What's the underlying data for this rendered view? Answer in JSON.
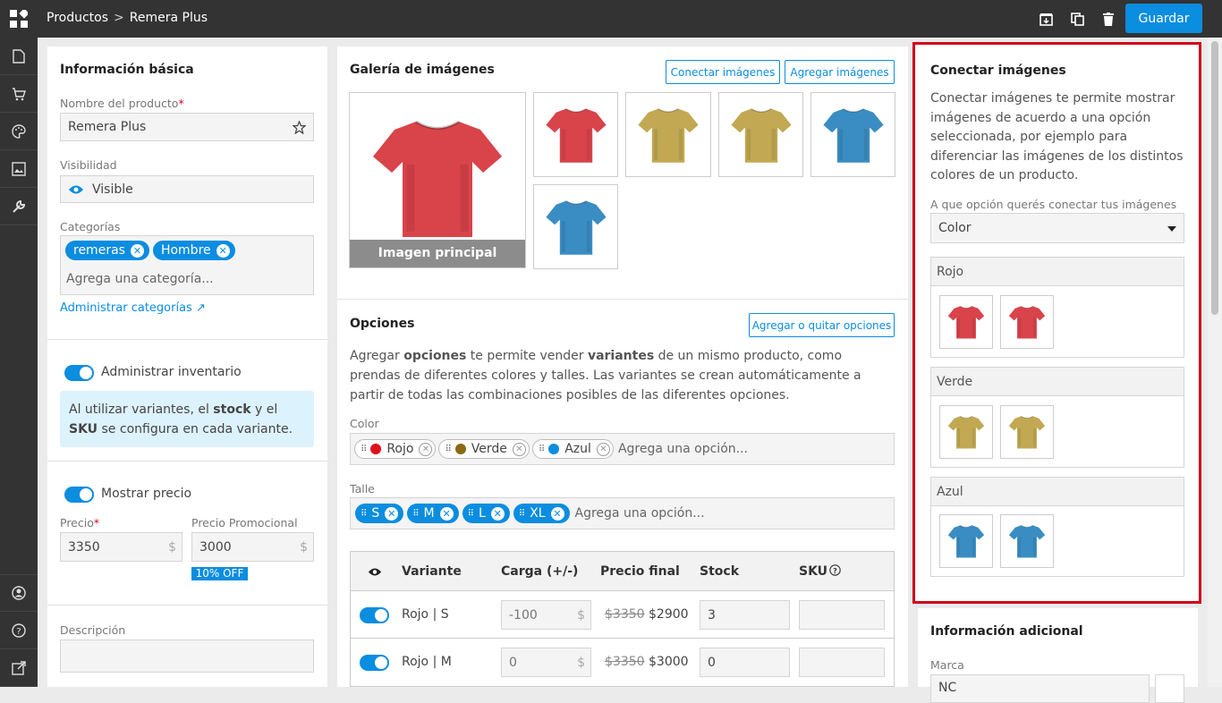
{
  "breadcrumb": {
    "parent": "Productos",
    "separator": ">",
    "current": "Remera Plus"
  },
  "toolbar": {
    "save_label": "Guardar"
  },
  "basic_info": {
    "title": "Información básica",
    "name_label": "Nombre del producto",
    "name_value": "Remera Plus",
    "visibility_label": "Visibilidad",
    "visibility_value": "Visible",
    "categories_label": "Categorías",
    "categories": [
      "remeras",
      "Hombre"
    ],
    "category_placeholder": "Agrega una categoría...",
    "manage_categories": "Administrar categorías ↗"
  },
  "inventory": {
    "toggle_label": "Administrar inventario",
    "info_pre": "Al utilizar variantes, el ",
    "info_stock": "stock",
    "info_mid": " y el ",
    "info_sku": "SKU",
    "info_post": " se configura en cada variante."
  },
  "pricing": {
    "toggle_label": "Mostrar precio",
    "price_label": "Precio",
    "price_value": "3350",
    "promo_label": "Precio Promocional",
    "promo_value": "3000",
    "currency": "$",
    "discount_badge": "10% OFF"
  },
  "description": {
    "label": "Descripción"
  },
  "gallery": {
    "title": "Galería de imágenes",
    "connect_button": "Conectar imágenes",
    "add_button": "Agregar imágenes",
    "main_caption": "Imagen principal"
  },
  "options": {
    "title": "Opciones",
    "button": "Agregar o quitar opciones",
    "desc_1": "Agregar ",
    "desc_b1": "opciones",
    "desc_2": " te permite vender ",
    "desc_b2": "variantes",
    "desc_3": " de un mismo producto, como prendas de diferentes colores y talles. Las variantes se crean automáticamente a partir de todas las combinaciones posibles de las diferentes opciones.",
    "color_label": "Color",
    "colors": [
      {
        "name": "Rojo",
        "hex": "#e0101a"
      },
      {
        "name": "Verde",
        "hex": "#8b6a12"
      },
      {
        "name": "Azul",
        "hex": "#0b8de0"
      }
    ],
    "color_placeholder": "Agrega una opción...",
    "size_label": "Talle",
    "sizes": [
      "S",
      "M",
      "L",
      "XL"
    ],
    "size_placeholder": "Agrega una opción..."
  },
  "variants": {
    "headers": {
      "variant": "Variante",
      "charge": "Carga (+/-)",
      "final_price": "Precio final",
      "stock": "Stock",
      "sku": "SKU"
    },
    "rows": [
      {
        "name": "Rojo | S",
        "charge": "-100",
        "old_price": "$3350",
        "new_price": "$2900",
        "stock": "3"
      },
      {
        "name": "Rojo | M",
        "charge": "0",
        "old_price": "$3350",
        "new_price": "$3000",
        "stock": "0"
      }
    ]
  },
  "connect": {
    "title": "Conectar imágenes",
    "description": "Conectar imágenes te permite mostrar imágenes de acuerdo a una opción seleccionada, por ejemplo para diferenciar las imágenes de los distintos colores de un producto.",
    "select_label": "A que opción querés conectar tus imágenes",
    "select_value": "Color",
    "groups": [
      "Rojo",
      "Verde",
      "Azul"
    ]
  },
  "additional": {
    "title": "Información adicional",
    "brand_label": "Marca",
    "brand_value": "NC"
  },
  "colors": {
    "accent": "#0b8de0",
    "topbar": "#333333",
    "highlight": "#d0021b",
    "shirt_red": "#d9434a",
    "shirt_olive": "#c2a852",
    "shirt_blue": "#3a8dc2"
  }
}
